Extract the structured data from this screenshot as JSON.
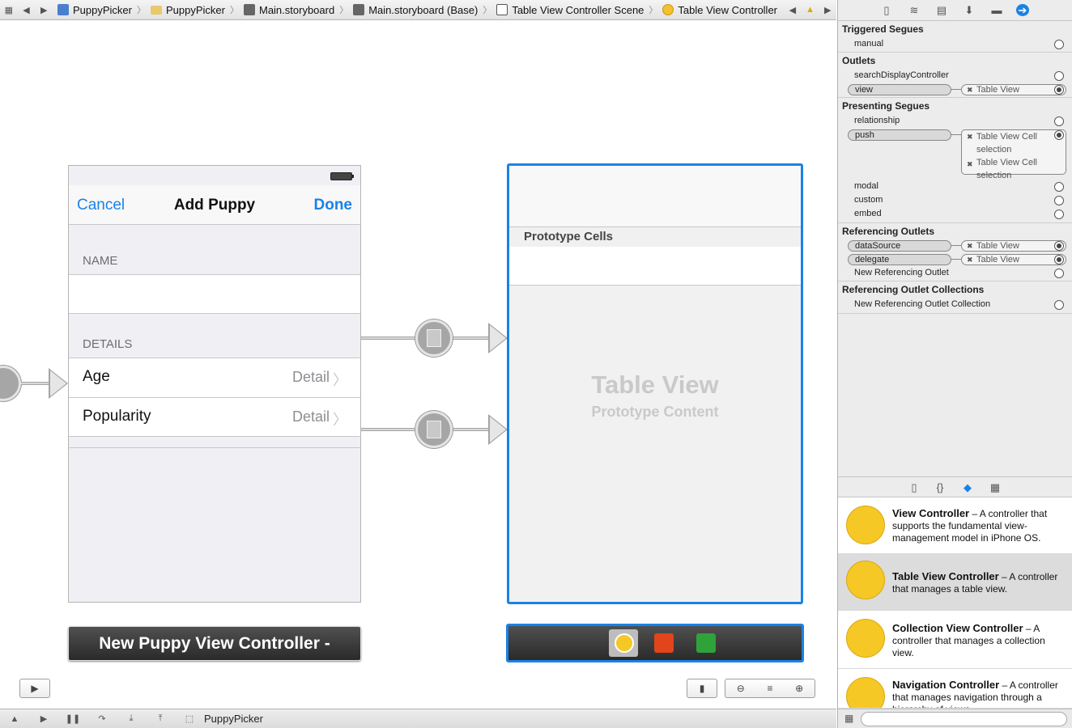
{
  "breadcrumbs": [
    "PuppyPicker",
    "PuppyPicker",
    "Main.storyboard",
    "Main.storyboard (Base)",
    "Table View Controller Scene",
    "Table View Controller"
  ],
  "left_scene": {
    "nav": {
      "cancel": "Cancel",
      "title": "Add Puppy",
      "done": "Done"
    },
    "sections": [
      {
        "header": "NAME"
      },
      {
        "header": "DETAILS"
      }
    ],
    "cells": [
      {
        "label": "Age",
        "detail": "Detail"
      },
      {
        "label": "Popularity",
        "detail": "Detail"
      }
    ],
    "scene_title": "New Puppy View Controller -"
  },
  "right_scene": {
    "prototype_header": "Prototype Cells",
    "placeholder_title": "Table View",
    "placeholder_subtitle": "Prototype Content"
  },
  "statusbar": {
    "target": "PuppyPicker"
  },
  "connections": {
    "triggered_segues": {
      "title": "Triggered Segues",
      "rows": [
        "manual"
      ]
    },
    "outlets": {
      "title": "Outlets",
      "rows": [
        "searchDisplayController",
        "view"
      ],
      "view_target": "Table View"
    },
    "presenting_segues": {
      "title": "Presenting Segues",
      "rows": [
        "relationship",
        "push",
        "modal",
        "custom",
        "embed"
      ],
      "push_targets": [
        "Table View Cell",
        "selection",
        "Table View Cell",
        "selection"
      ]
    },
    "referencing_outlets": {
      "title": "Referencing Outlets",
      "rows": [
        "dataSource",
        "delegate",
        "New Referencing Outlet"
      ],
      "targets": [
        "Table View",
        "Table View"
      ]
    },
    "referencing_collections": {
      "title": "Referencing Outlet Collections",
      "rows": [
        "New Referencing Outlet Collection"
      ]
    }
  },
  "library": [
    {
      "name": "View Controller",
      "desc": " – A controller that supports the fundamental view-management model in iPhone OS."
    },
    {
      "name": "Table View Controller",
      "desc": " – A controller that manages a table view."
    },
    {
      "name": "Collection View Controller",
      "desc": " – A controller that manages a collection view."
    },
    {
      "name": "Navigation Controller",
      "desc": " – A controller that manages navigation through a hierarchy of views."
    }
  ],
  "colors": {
    "accent": "#1a82e6",
    "scene_bar": "#333333",
    "library_icon": "#f6c825"
  }
}
